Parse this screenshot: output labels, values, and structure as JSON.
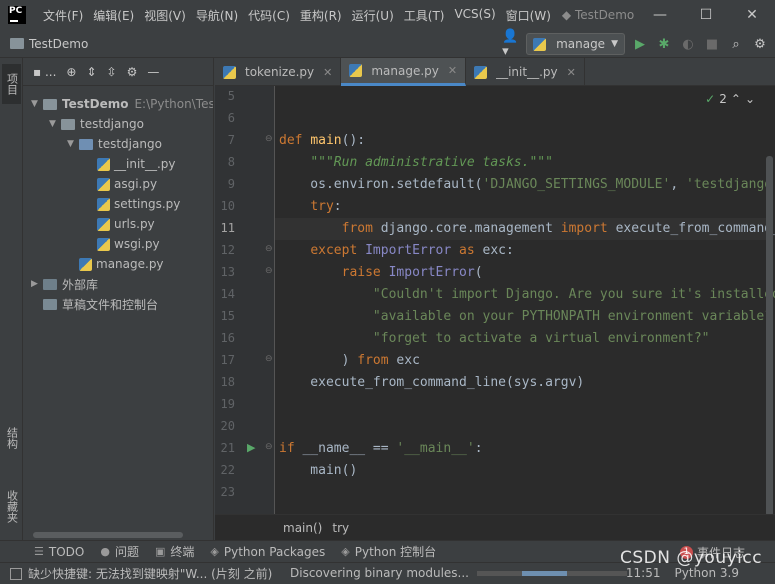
{
  "window": {
    "logo": "PC",
    "title": "TestDemo",
    "menu": [
      "文件(F)",
      "编辑(E)",
      "视图(V)",
      "导航(N)",
      "代码(C)",
      "重构(R)",
      "运行(U)",
      "工具(T)",
      "VCS(S)",
      "窗口(W)"
    ],
    "controls": [
      "—",
      "☐",
      "✕"
    ]
  },
  "navbar": {
    "project": "TestDemo",
    "run_config": "manage"
  },
  "left_stripe": {
    "project_tab": "项目",
    "structure_tab": "结构",
    "favorites_tab": "收藏夹"
  },
  "project_panel": {
    "toolbar_label": "▪ ...",
    "tree": [
      {
        "label": "TestDemo",
        "extra": "E:\\Python\\Tes",
        "type": "folder",
        "depth": 0,
        "expanded": true
      },
      {
        "label": "testdjango",
        "type": "folder",
        "depth": 1,
        "expanded": true
      },
      {
        "label": "testdjango",
        "type": "folder-blue",
        "depth": 2,
        "expanded": true
      },
      {
        "label": "__init__.py",
        "type": "py",
        "depth": 3
      },
      {
        "label": "asgi.py",
        "type": "py",
        "depth": 3
      },
      {
        "label": "settings.py",
        "type": "py",
        "depth": 3
      },
      {
        "label": "urls.py",
        "type": "py",
        "depth": 3
      },
      {
        "label": "wsgi.py",
        "type": "py",
        "depth": 3
      },
      {
        "label": "manage.py",
        "type": "py",
        "depth": 2
      },
      {
        "label": "外部库",
        "type": "lib",
        "depth": 0,
        "expanded": false
      },
      {
        "label": "草稿文件和控制台",
        "type": "scratch",
        "depth": 0
      }
    ]
  },
  "tabs": [
    {
      "label": "tokenize.py",
      "active": false
    },
    {
      "label": "manage.py",
      "active": true
    },
    {
      "label": "__init__.py",
      "active": false
    }
  ],
  "editor": {
    "inspection_count": "2",
    "current_line": 11,
    "lines": [
      {
        "n": "5",
        "html": ""
      },
      {
        "n": "6",
        "html": ""
      },
      {
        "n": "7",
        "html": "<span class='kw'>def</span> <span class='fn'>main</span>():"
      },
      {
        "n": "8",
        "html": "    <span class='doc'>\"\"\"Run administrative tasks.\"\"\"</span>"
      },
      {
        "n": "9",
        "html": "    os.environ.setdefault(<span class='st'>'DJANGO_SETTINGS_MODULE'</span>, <span class='st'>'testdjango.settings'</span>)"
      },
      {
        "n": "10",
        "html": "    <span class='kw'>try</span>:"
      },
      {
        "n": "11",
        "html": "        <span class='kw'>from</span> django.core.management <span class='kw'>import</span> execute_from_command_line"
      },
      {
        "n": "12",
        "html": "    <span class='kw'>except</span> <span class='cls'>ImportError</span> <span class='kw'>as</span> exc:"
      },
      {
        "n": "13",
        "html": "        <span class='kw'>raise</span> <span class='cls'>ImportError</span>("
      },
      {
        "n": "14",
        "html": "            <span class='st'>\"Couldn't import Django. Are you sure it's installed and \"</span>"
      },
      {
        "n": "15",
        "html": "            <span class='st'>\"available on your PYTHONPATH environment variable? Did you \"</span>"
      },
      {
        "n": "16",
        "html": "            <span class='st'>\"forget to activate a virtual environment?\"</span>"
      },
      {
        "n": "17",
        "html": "        ) <span class='kw'>from</span> exc"
      },
      {
        "n": "18",
        "html": "    execute_from_command_line(sys.argv)"
      },
      {
        "n": "19",
        "html": ""
      },
      {
        "n": "20",
        "html": ""
      },
      {
        "n": "21",
        "html": "<span class='kw'>if</span> __name__ == <span class='st'>'__main__'</span>:"
      },
      {
        "n": "22",
        "html": "    main()"
      },
      {
        "n": "23",
        "html": ""
      }
    ]
  },
  "breadcrumb": [
    "main()",
    "try"
  ],
  "tool_windows": [
    {
      "icon": "☰",
      "label": "TODO"
    },
    {
      "icon": "●",
      "label": "问题"
    },
    {
      "icon": "▣",
      "label": "终端"
    },
    {
      "icon": "◈",
      "label": "Python Packages"
    },
    {
      "icon": "◈",
      "label": "Python 控制台"
    }
  ],
  "event_log": {
    "count": "1",
    "label": "事件日志"
  },
  "status": {
    "message": "缺少快捷键: 无法找到键映射\"W... (片刻 之前)",
    "progress_text": "Discovering binary modules...",
    "position": "11:51",
    "interpreter": "Python 3.9"
  },
  "watermark": "CSDN @youyicc",
  "colors": {
    "keyword": "#cc7832",
    "function": "#ffc66d",
    "string": "#6a8759",
    "builtin_class": "#8888c6",
    "accent": "#4a88c7"
  }
}
